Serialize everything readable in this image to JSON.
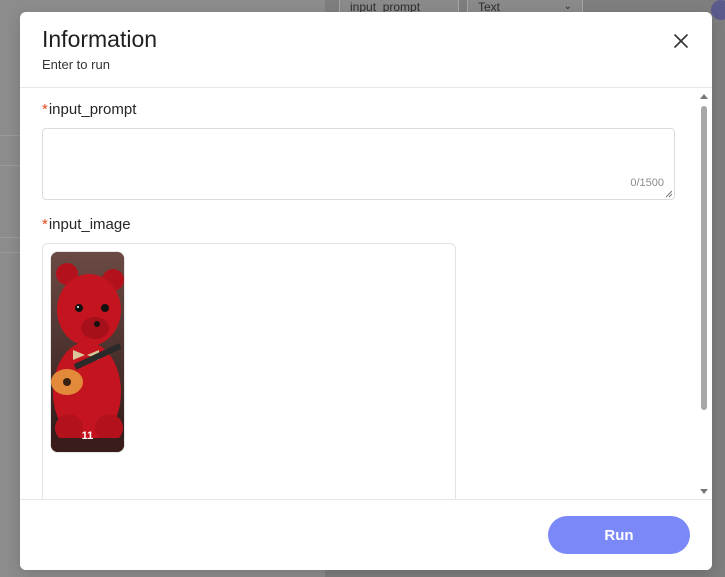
{
  "background": {
    "cells": [
      "input_prompt",
      "Text"
    ]
  },
  "modal": {
    "title": "Information",
    "subtitle": "Enter to run",
    "fields": [
      {
        "label": "input_prompt",
        "required_mark": "*",
        "value": "",
        "counter": "0/1500"
      },
      {
        "label": "input_image",
        "required_mark": "*",
        "thumbnail_caption": "11"
      }
    ],
    "run_label": "Run"
  },
  "colors": {
    "accent": "#7b88f8",
    "required": "#e2481f"
  }
}
